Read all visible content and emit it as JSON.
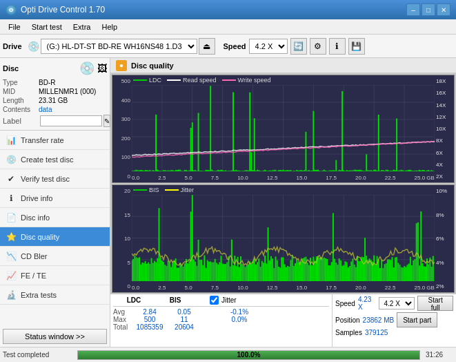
{
  "window": {
    "title": "Opti Drive Control 1.70",
    "min": "–",
    "max": "□",
    "close": "✕"
  },
  "menu": {
    "items": [
      "File",
      "Start test",
      "Extra",
      "Help"
    ]
  },
  "toolbar": {
    "drive_label": "Drive",
    "drive_value": "(G:)  HL-DT-ST BD-RE  WH16NS48 1.D3",
    "speed_label": "Speed",
    "speed_value": "4.2 X"
  },
  "disc": {
    "type_label": "Type",
    "type_value": "BD-R",
    "mid_label": "MID",
    "mid_value": "MILLENMR1 (000)",
    "length_label": "Length",
    "length_value": "23.31 GB",
    "contents_label": "Contents",
    "contents_value": "data",
    "label_label": "Label",
    "label_value": ""
  },
  "nav": {
    "items": [
      {
        "id": "transfer-rate",
        "label": "Transfer rate",
        "icon": "📊"
      },
      {
        "id": "create-test",
        "label": "Create test disc",
        "icon": "💿"
      },
      {
        "id": "verify-disc",
        "label": "Verify test disc",
        "icon": "✔"
      },
      {
        "id": "drive-info",
        "label": "Drive info",
        "icon": "ℹ"
      },
      {
        "id": "disc-info",
        "label": "Disc info",
        "icon": "📄"
      },
      {
        "id": "disc-quality",
        "label": "Disc quality",
        "icon": "⭐",
        "active": true
      },
      {
        "id": "cd-bler",
        "label": "CD Bler",
        "icon": "📉"
      },
      {
        "id": "fe-te",
        "label": "FE / TE",
        "icon": "📈"
      },
      {
        "id": "extra-tests",
        "label": "Extra tests",
        "icon": "🔬"
      }
    ],
    "status_btn": "Status window >>"
  },
  "disc_quality": {
    "title": "Disc quality",
    "legend": {
      "ldc": "LDC",
      "read_speed": "Read speed",
      "write_speed": "Write speed",
      "bis": "BIS",
      "jitter": "Jitter"
    },
    "chart1": {
      "y_max": 500,
      "y_labels": [
        "500",
        "400",
        "300",
        "200",
        "100",
        "0"
      ],
      "y_right": [
        "18X",
        "16X",
        "14X",
        "12X",
        "10X",
        "8X",
        "6X",
        "4X",
        "2X"
      ],
      "x_labels": [
        "0.0",
        "2.5",
        "5.0",
        "7.5",
        "10.0",
        "12.5",
        "15.0",
        "17.5",
        "20.0",
        "22.5",
        "25.0"
      ],
      "x_unit": "GB"
    },
    "chart2": {
      "y_labels": [
        "20",
        "15",
        "10",
        "5",
        "0"
      ],
      "y_right": [
        "10%",
        "8%",
        "6%",
        "4%",
        "2%"
      ],
      "x_labels": [
        "0.0",
        "2.5",
        "5.0",
        "7.5",
        "10.0",
        "12.5",
        "15.0",
        "17.5",
        "20.0",
        "22.5",
        "25.0"
      ],
      "x_unit": "GB"
    }
  },
  "stats": {
    "headers": [
      "LDC",
      "BIS",
      "",
      "Jitter",
      "Speed",
      ""
    ],
    "jitter_checked": true,
    "jitter_label": "Jitter",
    "speed_label": "Speed",
    "speed_value": "4.23 X",
    "speed_select": "4.2 X",
    "avg_label": "Avg",
    "avg_ldc": "2.84",
    "avg_bis": "0.05",
    "avg_jitter": "-0.1%",
    "max_label": "Max",
    "max_ldc": "500",
    "max_bis": "11",
    "max_jitter": "0.0%",
    "total_label": "Total",
    "total_ldc": "1085359",
    "total_bis": "20604",
    "position_label": "Position",
    "position_value": "23862 MB",
    "samples_label": "Samples",
    "samples_value": "379125",
    "start_full": "Start full",
    "start_part": "Start part"
  },
  "status_bar": {
    "text": "Test completed",
    "progress": 100,
    "progress_text": "100.0%",
    "time": "31:26"
  },
  "colors": {
    "ldc": "#00cc00",
    "read_speed": "#ffffff",
    "write_speed": "#ff69b4",
    "bis": "#00cc00",
    "jitter": "#ffff00",
    "chart_bg": "#2a2a4a",
    "grid": "#4a4a6a"
  }
}
